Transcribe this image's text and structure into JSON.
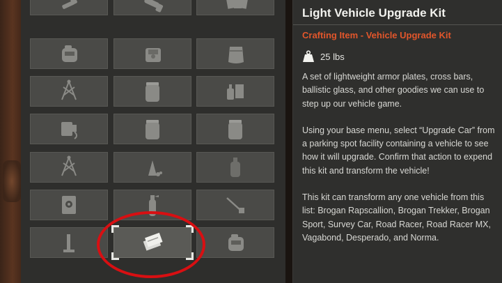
{
  "inventory": {
    "slots": [
      {
        "icon": "bolt-icon"
      },
      {
        "icon": "flashlight-icon"
      },
      {
        "icon": "seed-packets-icon"
      },
      {
        "icon": "generator-icon"
      },
      {
        "icon": "supply-bag-icon"
      },
      {
        "icon": "sack-icon"
      },
      {
        "icon": "tripod-tools-icon"
      },
      {
        "icon": "jar-icon"
      },
      {
        "icon": "chemicals-icon"
      },
      {
        "icon": "gadget-icon"
      },
      {
        "icon": "jar-icon"
      },
      {
        "icon": "jar-icon"
      },
      {
        "icon": "tripod-tools-icon"
      },
      {
        "icon": "ammo-pile-icon"
      },
      {
        "icon": "bottle-icon"
      },
      {
        "icon": "safe-icon"
      },
      {
        "icon": "fire-extinguisher-icon"
      },
      {
        "icon": "tool-icon"
      },
      {
        "icon": "drill-icon"
      },
      {
        "icon": "vehicle-upgrade-kit-icon"
      },
      {
        "icon": "generator-icon"
      }
    ],
    "selected_index": 19
  },
  "detail": {
    "title": "Light Vehicle Upgrade Kit",
    "subtitle": "Crafting Item - Vehicle Upgrade Kit",
    "weight_icon": "weight-icon",
    "weight": "25 lbs",
    "paragraphs": [
      "A set of lightweight armor plates, cross bars, ballistic glass, and other goodies we can use to step up our vehicle game.",
      "Using your base menu, select “Upgrade Car” from a parking spot facility containing a vehicle to see how it will upgrade. Confirm that action to expend this kit and transform the vehicle!",
      "This kit can transform any one vehicle from this list: Brogan Rapscallion, Brogan Trekker, Brogan Sport, Survey Car, Road Racer, Road Racer MX, Vagabond, Desperado, and Norma."
    ]
  },
  "colors": {
    "accent_subtitle": "#e2562b",
    "highlight_ring": "#d80f12",
    "slot_bg": "#4a4a47",
    "panel_bg": "#2f2f2d"
  }
}
